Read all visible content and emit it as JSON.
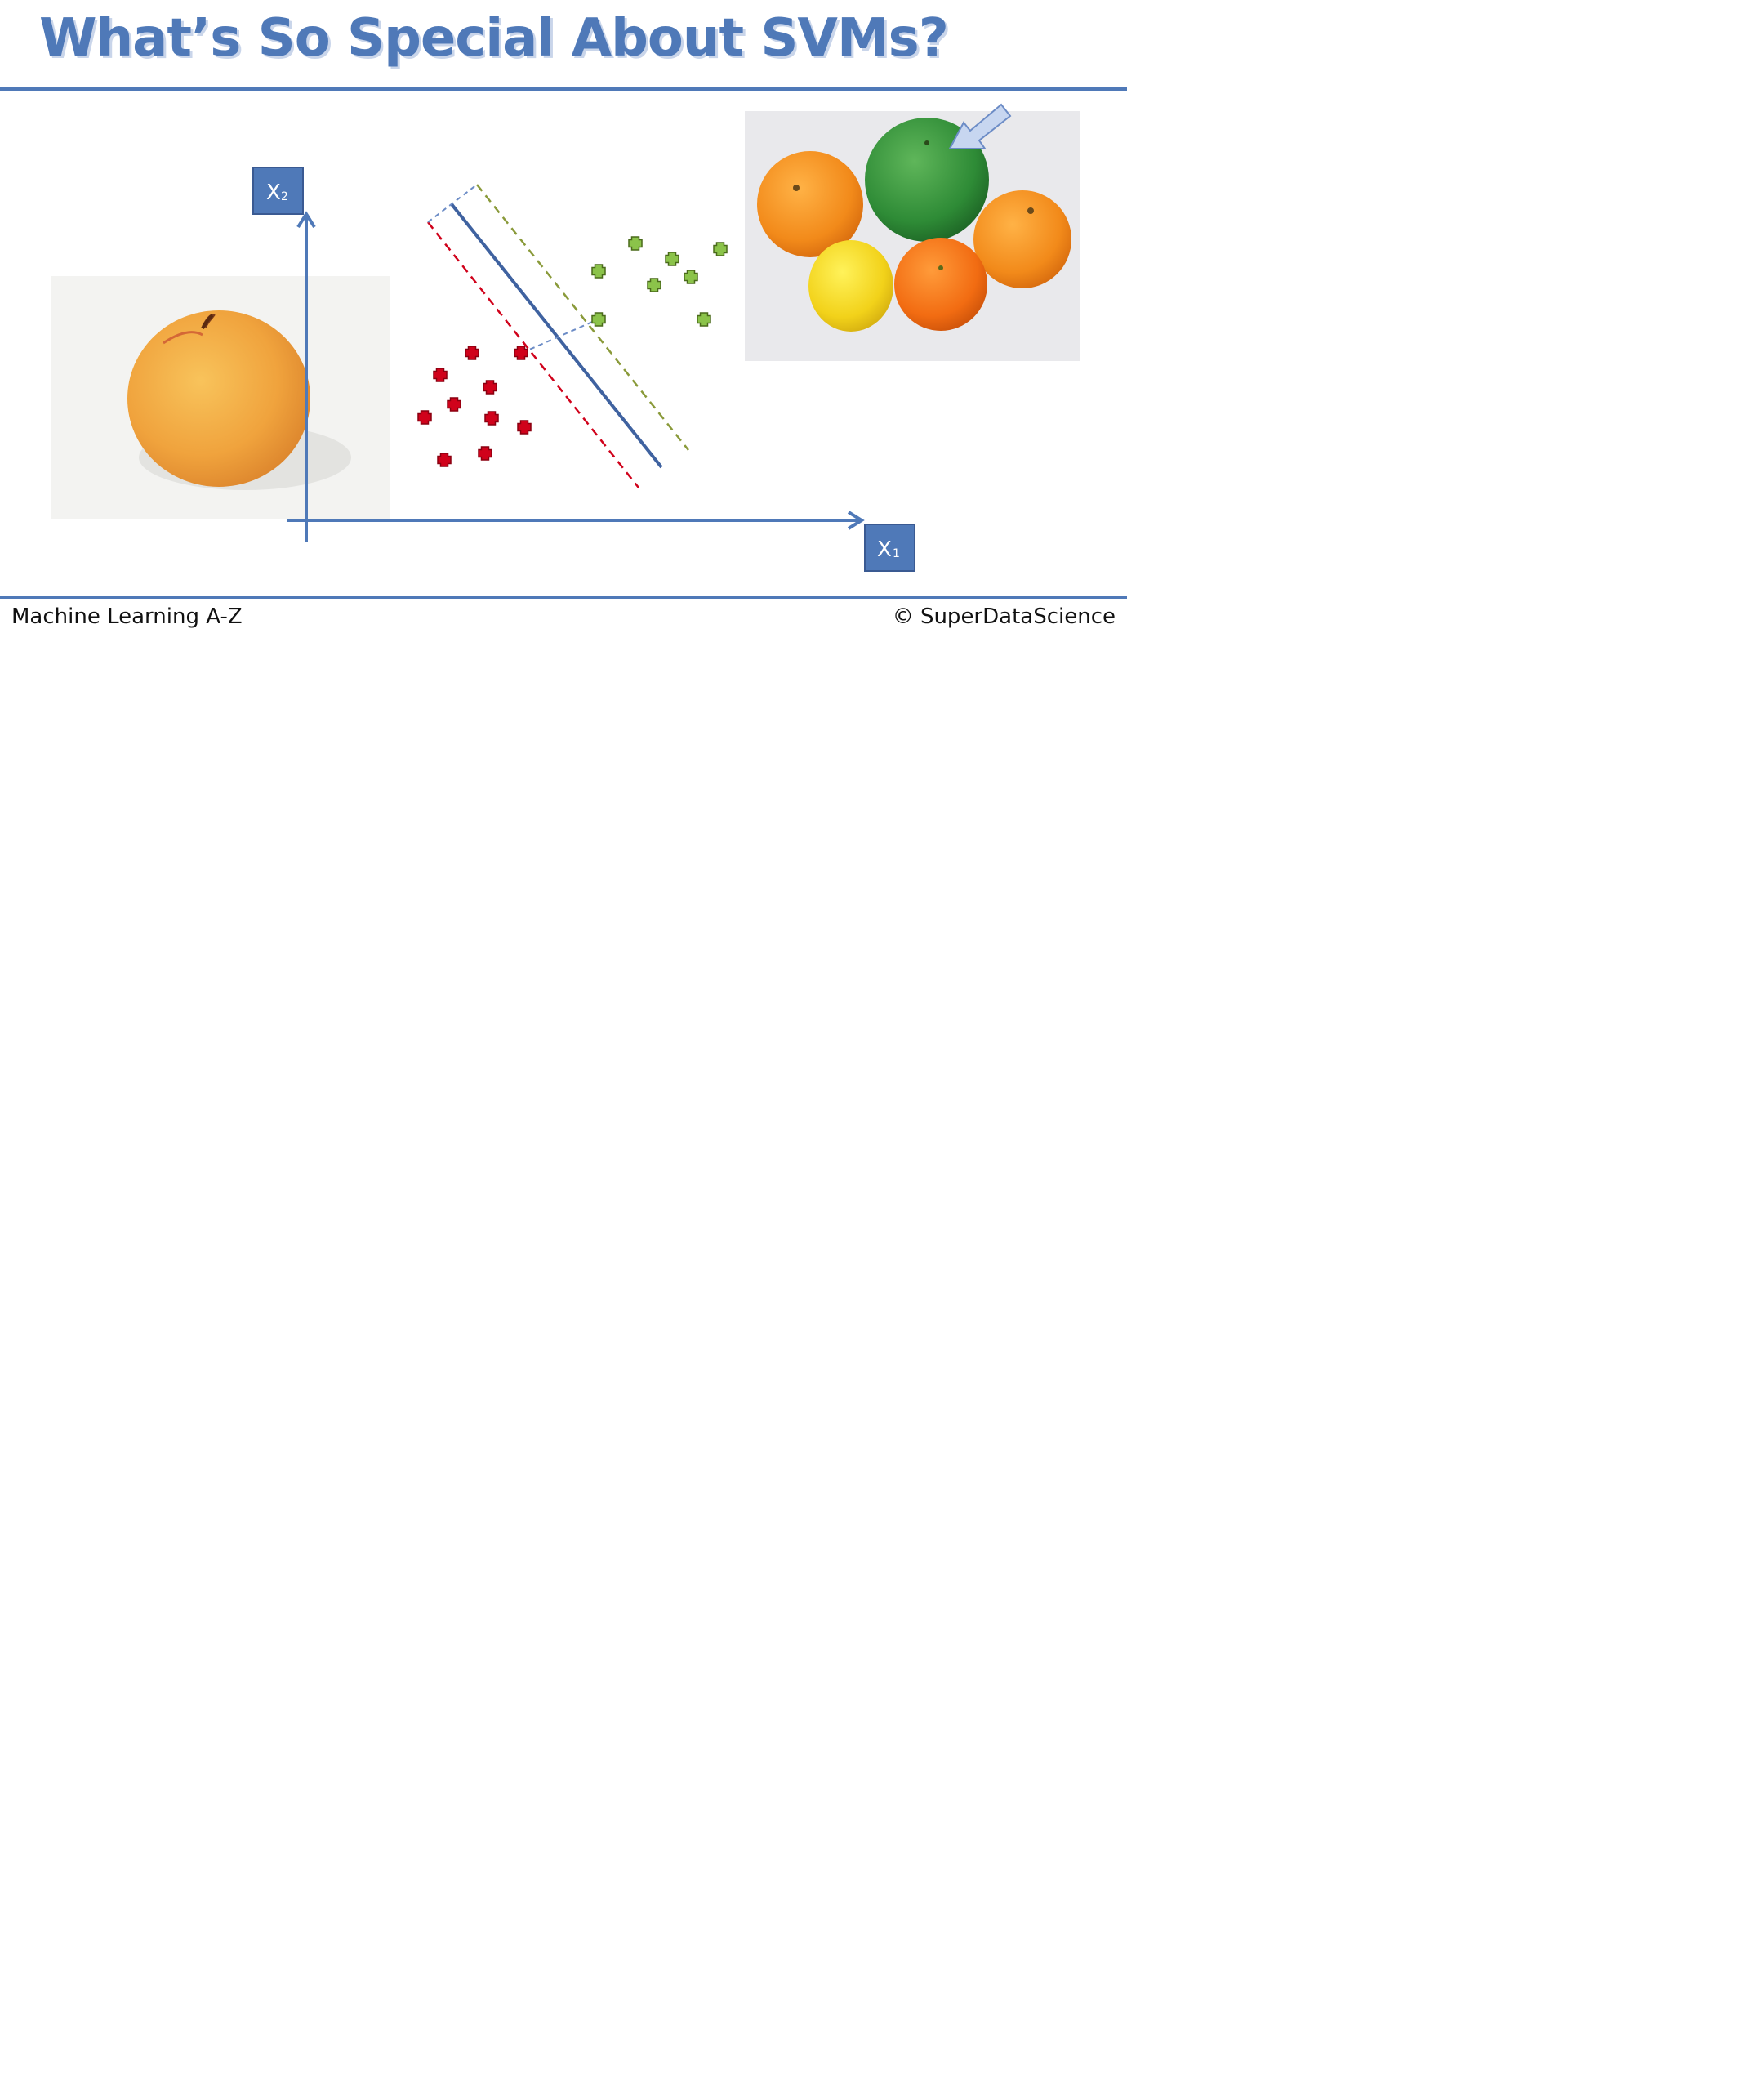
{
  "slide": {
    "title": "What’s So Special About SVMs?",
    "footer_left": "Machine Learning A-Z",
    "footer_right": "© SuperDataScience"
  },
  "axes": {
    "x_label": "X",
    "x_sub": "1",
    "y_label": "X",
    "y_sub": "2"
  },
  "colors": {
    "accent": "#4f79b8",
    "red_class": "#d0021b",
    "green_class": "#8bc34a",
    "hyperplane": "#3f62a0"
  },
  "icons": {
    "left_image": "apple-image",
    "right_image": "oranges-with-grapefruit-image",
    "pointer": "arrow-pointer-icon"
  }
}
